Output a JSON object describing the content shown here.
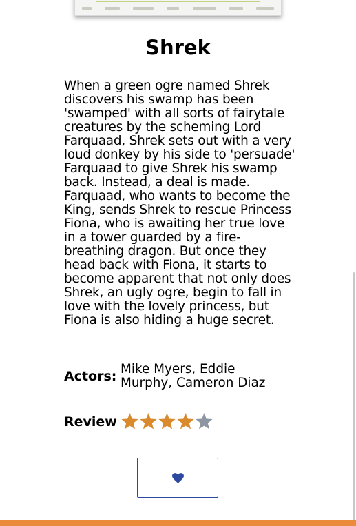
{
  "movie": {
    "title": "Shrek",
    "synopsis": "When a green ogre named Shrek discovers his swamp has been 'swamped' with all sorts of fairytale creatures by the scheming Lord Farquaad, Shrek sets out with a very loud donkey by his side to 'persuade' Farquaad to give Shrek his swamp back. Instead, a deal is made. Farquaad, who wants to become the King, sends Shrek to rescue Princess Fiona, who is awaiting her true love in a tower guarded by a fire-breathing dragon. But once they head back with Fiona, it starts to become apparent that not only does Shrek, an ugly ogre, begin to fall in love with the lovely princess, but Fiona is also hiding a huge secret.",
    "actors_label": "Actors:",
    "actors": "Mike Myers, Eddie Murphy, Cameron Diaz",
    "review_label": "Review",
    "rating": 4,
    "rating_max": 5
  },
  "favorite_button": {
    "icon": "heart-icon"
  },
  "colors": {
    "star_filled": "#d98a2c",
    "star_empty": "#8e96a3",
    "heart": "#2d4aa0",
    "button_border": "#2d4aa0",
    "footer_bar": "#ea8a3b"
  }
}
